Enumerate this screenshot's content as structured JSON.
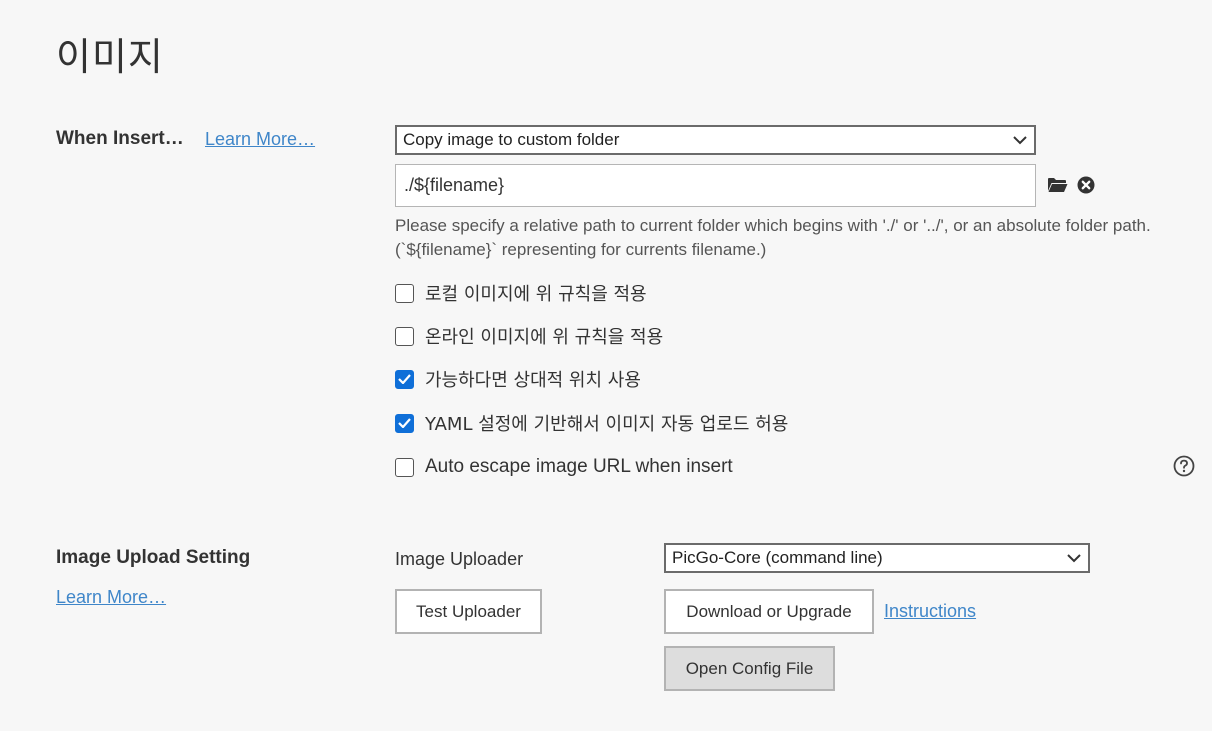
{
  "page": {
    "title": "이미지"
  },
  "when_insert": {
    "label": "When Insert…",
    "learn_more": "Learn More…",
    "action_select": {
      "selected": "Copy image to custom folder"
    },
    "path_input": {
      "value": "./${filename}"
    },
    "path_hint": " Please specify a relative path to current folder which begins with './' or '../', or an absolute folder path. (`${filename}` representing for currents filename.)",
    "options": [
      {
        "label": "로컬 이미지에 위 규칙을 적용",
        "checked": false
      },
      {
        "label": "온라인 이미지에 위 규칙을 적용",
        "checked": false
      },
      {
        "label": "가능하다면 상대적 위치 사용",
        "checked": true
      },
      {
        "label": "YAML 설정에 기반해서 이미지 자동 업로드 허용",
        "checked": true
      },
      {
        "label": "Auto escape image URL when insert",
        "checked": false
      }
    ]
  },
  "upload": {
    "label": "Image Upload Setting",
    "learn_more": "Learn More…",
    "uploader_label": "Image Uploader",
    "uploader_select": {
      "selected": "PicGo-Core (command line)"
    },
    "test_button": "Test Uploader",
    "download_button": "Download or Upgrade",
    "instructions_link": "Instructions",
    "open_config_button": "Open Config File"
  },
  "colors": {
    "link": "#3f86c9",
    "checkbox_checked": "#0f6fd8",
    "background": "#f7f7f7"
  },
  "icons": {
    "folder": "folder-icon",
    "clear": "clear-circle-icon",
    "help": "help-circle-icon",
    "chevron": "chevron-down-icon",
    "check": "checkmark-icon"
  }
}
